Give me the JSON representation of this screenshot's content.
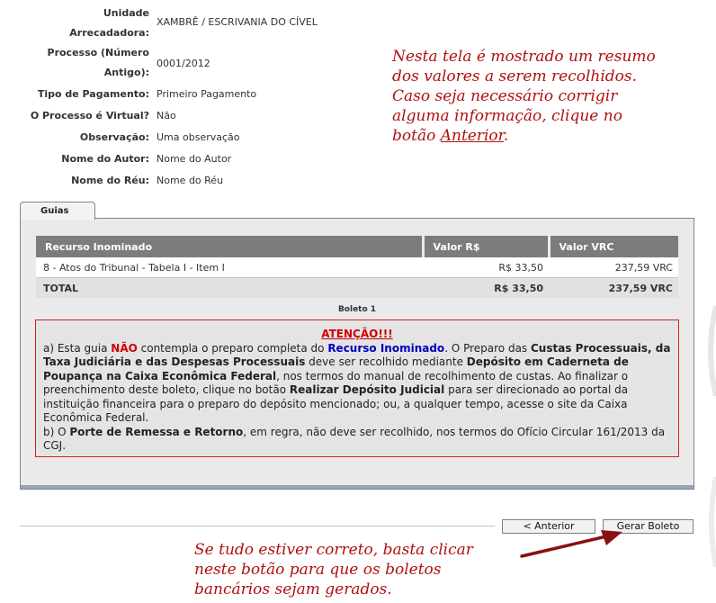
{
  "form": [
    {
      "label": "Unidade Arrecadadora:",
      "value": "XAMBRÊ / ESCRIVANIA DO CÍVEL"
    },
    {
      "label": "Processo (Número Antigo):",
      "value": "0001/2012"
    },
    {
      "label": "Tipo de Pagamento:",
      "value": "Primeiro Pagamento"
    },
    {
      "label": "O Processo é Virtual?",
      "value": "Não"
    },
    {
      "label": "Observação:",
      "value": "Uma observação"
    },
    {
      "label": "Nome do Autor:",
      "value": "Nome do Autor"
    },
    {
      "label": "Nome do Réu:",
      "value": "Nome do Réu"
    }
  ],
  "form_split": {
    "unidade_l1": "Unidade",
    "unidade_l2": "Arrecadadora:",
    "processo_l1": "Processo (Número",
    "processo_l2": "Antigo):"
  },
  "note_top": {
    "line1": "Nesta tela é mostrado um resumo",
    "line2": "dos valores a serem recolhidos.",
    "line3": "Caso seja necessário corrigir",
    "line4": "alguma informação, clique no",
    "line5_prefix": "botão ",
    "line5_link": "Anterior",
    "line5_suffix": "."
  },
  "tab": {
    "label": "Guias"
  },
  "table": {
    "headers": [
      "Recurso Inominado",
      "Valor R$",
      "Valor VRC"
    ],
    "rows": [
      {
        "desc": "8 - Atos do Tribunal - Tabela I - Item I",
        "valor": "R$ 33,50",
        "vrc": "237,59 VRC"
      }
    ],
    "total": {
      "label": "TOTAL",
      "valor": "R$ 33,50",
      "vrc": "237,59 VRC"
    }
  },
  "boleto_label": "Boleto 1",
  "alert": {
    "title": "ATENÇÃO!!!",
    "a_prefix": "a) Esta guia ",
    "nao": "NÃO",
    "a_mid1": " contempla o preparo completa do ",
    "recurso": "Recurso Inominado",
    "a_mid2": ". O Preparo das ",
    "custas": "Custas Processuais, da Taxa Judiciária e das Despesas Processuais",
    "a_mid3": " deve ser recolhido mediante ",
    "deposito": "Depósito em Caderneta de Poupança na Caixa Econômica Federal",
    "a_mid4": ", nos termos do manual de recolhimento de custas. Ao finalizar o preenchimento deste boleto, clique no botão ",
    "realizar": "Realizar Depósito Judicial",
    "a_end": " para ser direcionado ao portal da instituição financeira para o preparo do depósito mencionado; ou, a qualquer tempo, acesse o site da Caixa Econômica Federal.",
    "b_prefix": "b) O ",
    "porte": "Porte de Remessa e Retorno",
    "b_end": ", em regra, não deve ser recolhido, nos termos do Ofício Circular 161/2013 da CGJ."
  },
  "buttons": {
    "anterior": "< Anterior",
    "gerar": "Gerar Boleto"
  },
  "note_bottom": {
    "line1": "Se tudo estiver correto, basta clicar",
    "line2": "neste botão para que os boletos",
    "line3": "bancários sejam gerados."
  },
  "colors": {
    "annotation": "#b01010",
    "alert_border": "#d02020",
    "header_bg": "#7c7c7c"
  }
}
